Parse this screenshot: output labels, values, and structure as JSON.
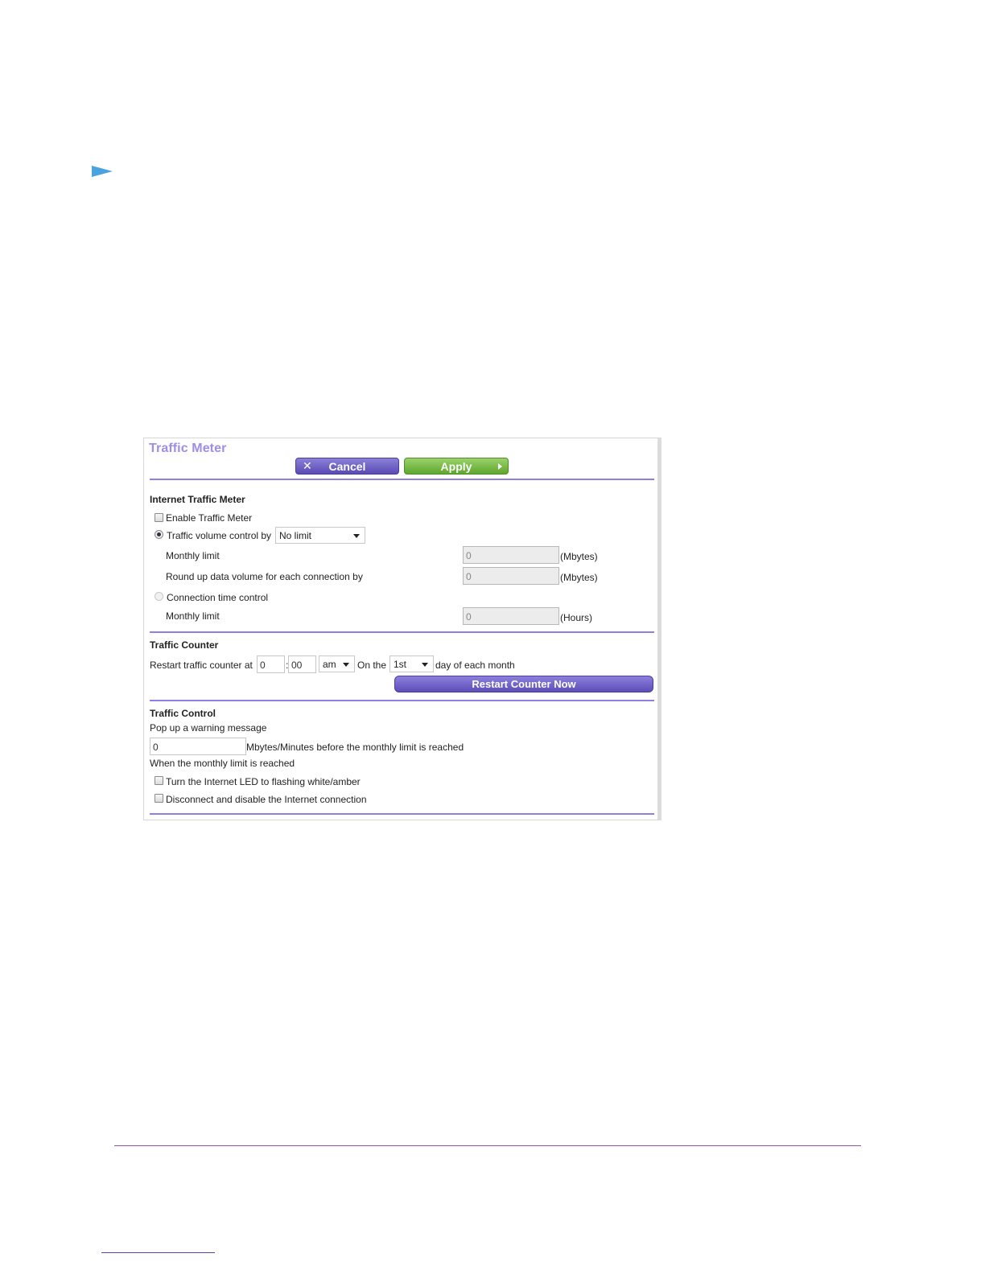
{
  "panel": {
    "title": "Traffic Meter",
    "cancel_label": "Cancel",
    "apply_label": "Apply"
  },
  "internet_meter": {
    "heading": "Internet Traffic Meter",
    "enable_label": "Enable Traffic Meter",
    "enable_checked": false,
    "volume_label": "Traffic volume control by",
    "volume_selected": true,
    "volume_option": "No limit",
    "monthly_limit_label": "Monthly limit",
    "monthly_limit_value": "0",
    "monthly_limit_unit": "(Mbytes)",
    "round_up_label": "Round up data volume for each connection by",
    "round_up_value": "0",
    "round_up_unit": "(Mbytes)",
    "time_label": "Connection time control",
    "time_selected": false,
    "time_monthly_label": "Monthly limit",
    "time_monthly_value": "0",
    "time_monthly_unit": "(Hours)"
  },
  "traffic_counter": {
    "heading": "Traffic Counter",
    "restart_label": "Restart traffic counter at",
    "hour_value": "0",
    "colon": ":",
    "minute_value": "00",
    "ampm_value": "am",
    "on_the_label": "On the",
    "day_value": "1st",
    "day_suffix": "day of each month",
    "restart_button": "Restart Counter Now"
  },
  "traffic_control": {
    "heading": "Traffic Control",
    "popup_label": "Pop up a warning message",
    "popup_value": "0",
    "popup_suffix": "Mbytes/Minutes before the monthly limit is reached",
    "when_label": "When the monthly limit is reached",
    "led_label": "Turn the Internet LED to flashing white/amber",
    "disconnect_label": "Disconnect and disable the Internet connection"
  },
  "colors": {
    "title": "#9c8fe8",
    "purple_button": "#5a4bb3",
    "green_button": "#5fa62f",
    "rule": "#8e7fe0"
  }
}
